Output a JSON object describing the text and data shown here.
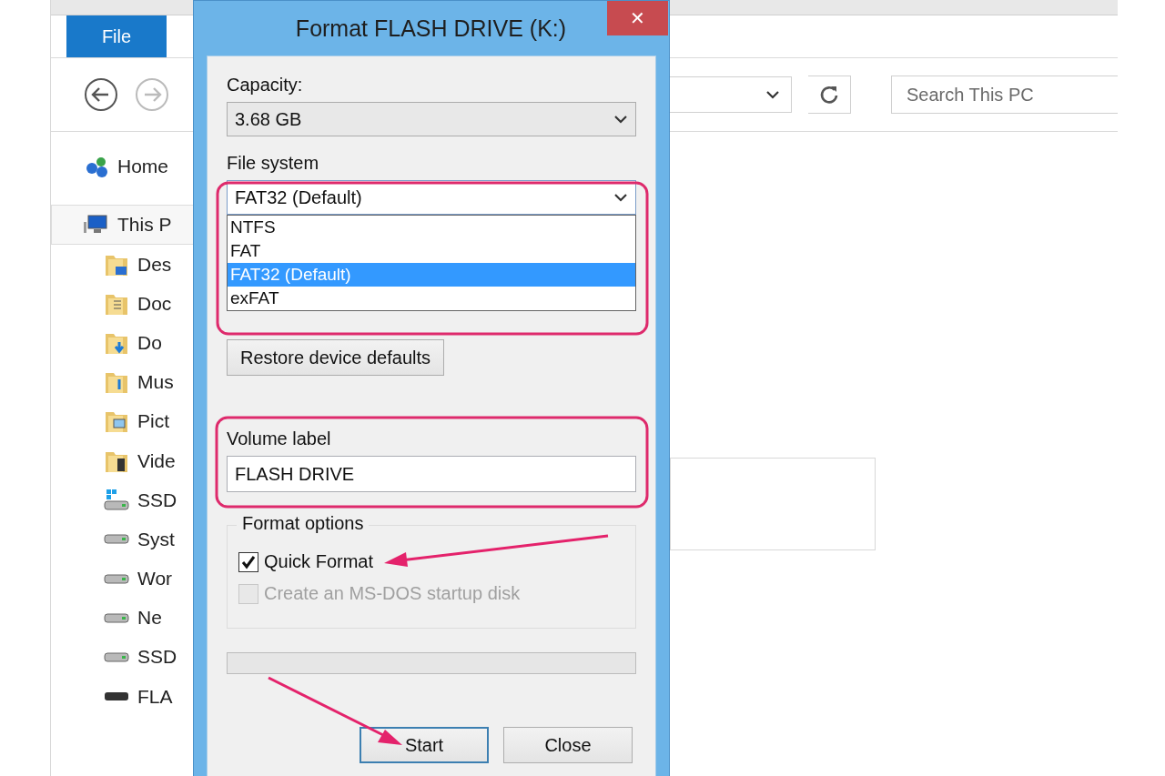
{
  "explorer": {
    "ribbon_tabs": [
      {
        "label": "File",
        "selected": true
      }
    ],
    "search": {
      "placeholder": "Search This PC"
    },
    "nav_tree": [
      {
        "label": "Home",
        "kind": "home",
        "selected": false
      },
      {
        "label": "This P",
        "kind": "pc",
        "selected": true,
        "children": [
          {
            "label": "Des",
            "kind": "desktop",
            "selected": false
          },
          {
            "label": "Doc",
            "kind": "documents",
            "selected": false
          },
          {
            "label": "Do",
            "kind": "downloads",
            "selected": false
          },
          {
            "label": "Mus",
            "kind": "music",
            "selected": false
          },
          {
            "label": "Pict",
            "kind": "pictures",
            "selected": false
          },
          {
            "label": "Vide",
            "kind": "videos",
            "selected": false
          },
          {
            "label": "SSD",
            "kind": "system-drive",
            "selected": false
          },
          {
            "label": "Syst",
            "kind": "drive",
            "selected": false
          },
          {
            "label": "Wor",
            "kind": "drive",
            "selected": false
          },
          {
            "label": "Ne",
            "kind": "drive",
            "selected": false
          },
          {
            "label": "SSD",
            "kind": "drive",
            "selected": false
          },
          {
            "label": "FLA",
            "kind": "usb",
            "selected": false
          }
        ]
      }
    ]
  },
  "dialog": {
    "title": "Format FLASH DRIVE (K:)",
    "close": "✕",
    "capacity": {
      "label": "Capacity:",
      "value": "3.68 GB"
    },
    "file_system": {
      "label": "File system",
      "value": "FAT32 (Default)",
      "expanded": true,
      "options": [
        {
          "label": "NTFS",
          "selected": false
        },
        {
          "label": "FAT",
          "selected": false
        },
        {
          "label": "FAT32 (Default)",
          "selected": true
        },
        {
          "label": "exFAT",
          "selected": false
        }
      ]
    },
    "restore_button": "Restore device defaults",
    "volume_label": {
      "label": "Volume label",
      "value": "FLASH DRIVE"
    },
    "format_options": {
      "legend": "Format options",
      "checkboxes": [
        {
          "label": "Quick Format",
          "checked": true,
          "disabled": false
        },
        {
          "label": "Create an MS-DOS startup disk",
          "checked": false,
          "disabled": true
        }
      ]
    },
    "progress": {
      "level": 0
    },
    "buttons": [
      {
        "label": "Start",
        "default": true
      },
      {
        "label": "Close",
        "default": false
      }
    ]
  }
}
